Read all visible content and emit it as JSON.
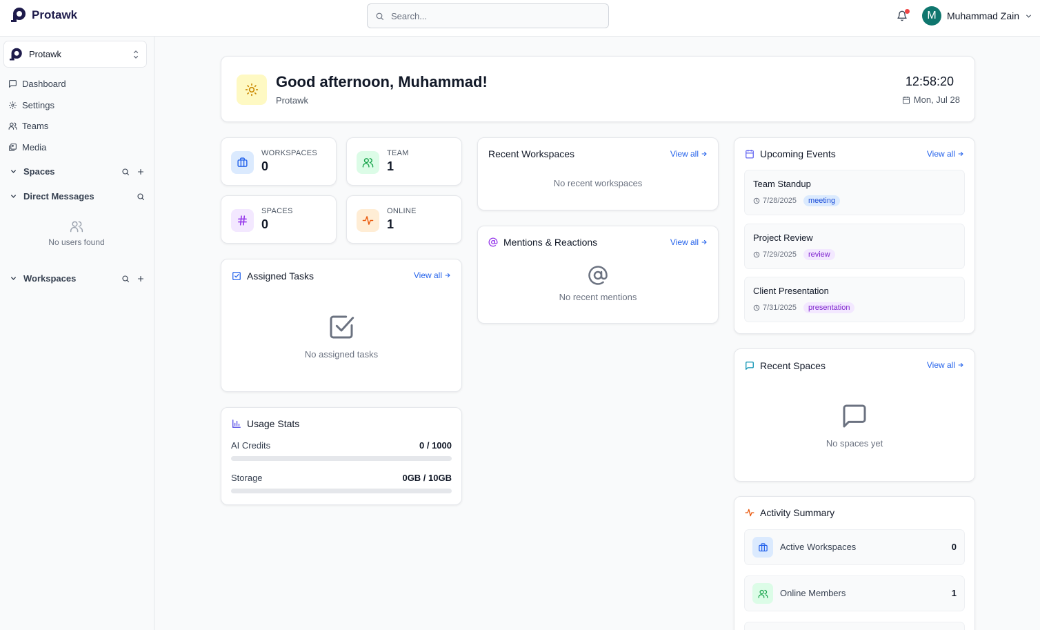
{
  "brand": {
    "name": "Protawk"
  },
  "search": {
    "placeholder": "Search..."
  },
  "user": {
    "initial": "M",
    "name": "Muhammad Zain"
  },
  "sidebar": {
    "org_name": "Protawk",
    "nav": [
      {
        "label": "Dashboard",
        "icon": "message-square-icon"
      },
      {
        "label": "Settings",
        "icon": "gear-icon"
      },
      {
        "label": "Teams",
        "icon": "users-icon"
      },
      {
        "label": "Media",
        "icon": "images-icon"
      }
    ],
    "sections": {
      "spaces": "Spaces",
      "direct_messages": "Direct Messages",
      "workspaces": "Workspaces"
    },
    "dm_empty": "No users found"
  },
  "greeting": {
    "title": "Good afternoon, Muhammad!",
    "subtitle": "Protawk",
    "time": "12:58:20",
    "date": "Mon, Jul 28"
  },
  "stats": [
    {
      "label": "WORKSPACES",
      "value": "0",
      "icon": "briefcase-icon",
      "color": "#2563eb"
    },
    {
      "label": "TEAM",
      "value": "1",
      "icon": "users-icon",
      "color": "#16a34a"
    },
    {
      "label": "SPACES",
      "value": "0",
      "icon": "hash-icon",
      "color": "#9333ea"
    },
    {
      "label": "ONLINE",
      "value": "1",
      "icon": "activity-icon",
      "color": "#ea580c"
    }
  ],
  "assigned_tasks": {
    "title": "Assigned Tasks",
    "view_all": "View all",
    "empty": "No assigned tasks"
  },
  "usage": {
    "title": "Usage Stats",
    "rows": [
      {
        "label": "AI Credits",
        "value": "0 / 1000",
        "fraction": 0
      },
      {
        "label": "Storage",
        "value": "0GB / 10GB",
        "fraction": 0
      }
    ]
  },
  "recent_workspaces": {
    "title": "Recent Workspaces",
    "view_all": "View all",
    "empty": "No recent workspaces"
  },
  "mentions": {
    "title": "Mentions & Reactions",
    "view_all": "View all",
    "empty": "No recent mentions"
  },
  "events": {
    "title": "Upcoming Events",
    "view_all": "View all",
    "items": [
      {
        "title": "Team Standup",
        "date": "7/28/2025",
        "tag": "meeting",
        "tag_bg": "#dbeafe",
        "tag_color": "#1d4ed8"
      },
      {
        "title": "Project Review",
        "date": "7/29/2025",
        "tag": "review",
        "tag_bg": "#f3e8ff",
        "tag_color": "#7e22ce"
      },
      {
        "title": "Client Presentation",
        "date": "7/31/2025",
        "tag": "presentation",
        "tag_bg": "#f3e8ff",
        "tag_color": "#7e22ce"
      }
    ]
  },
  "recent_spaces": {
    "title": "Recent Spaces",
    "view_all": "View all",
    "empty": "No spaces yet"
  },
  "activity": {
    "title": "Activity Summary",
    "rows": [
      {
        "label": "Active Workspaces",
        "value": "0"
      },
      {
        "label": "Online Members",
        "value": "1"
      }
    ]
  }
}
